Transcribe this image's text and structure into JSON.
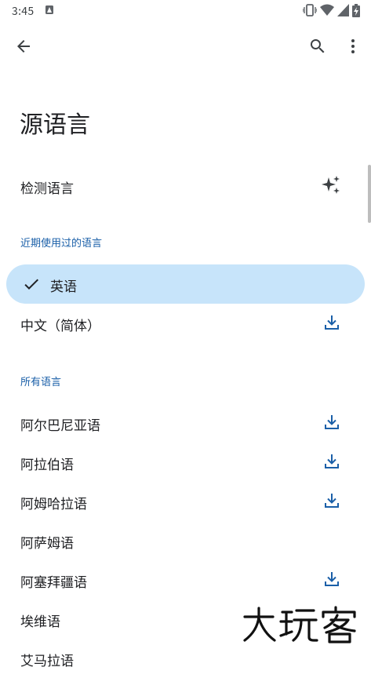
{
  "status_bar": {
    "time": "3:45"
  },
  "header": {
    "back_icon": "arrow-back-icon",
    "search_icon": "search-icon",
    "more_icon": "more-vert-icon"
  },
  "page": {
    "title": "源语言"
  },
  "detect": {
    "label": "检测语言",
    "icon": "sparkle-icon"
  },
  "recent": {
    "header": "近期使用过的语言",
    "items": [
      {
        "label": "英语",
        "selected": true,
        "downloadable": false
      },
      {
        "label": "中文（简体）",
        "selected": false,
        "downloadable": true
      }
    ]
  },
  "all": {
    "header": "所有语言",
    "items": [
      {
        "label": "阿尔巴尼亚语",
        "downloadable": true
      },
      {
        "label": "阿拉伯语",
        "downloadable": true
      },
      {
        "label": "阿姆哈拉语",
        "downloadable": true
      },
      {
        "label": "阿萨姆语",
        "downloadable": false
      },
      {
        "label": "阿塞拜疆语",
        "downloadable": true
      },
      {
        "label": "埃维语",
        "downloadable": false
      },
      {
        "label": "艾马拉语",
        "downloadable": false
      }
    ]
  },
  "colors": {
    "accent": "#1a5fa8",
    "selected_bg": "#c7e4fa"
  }
}
